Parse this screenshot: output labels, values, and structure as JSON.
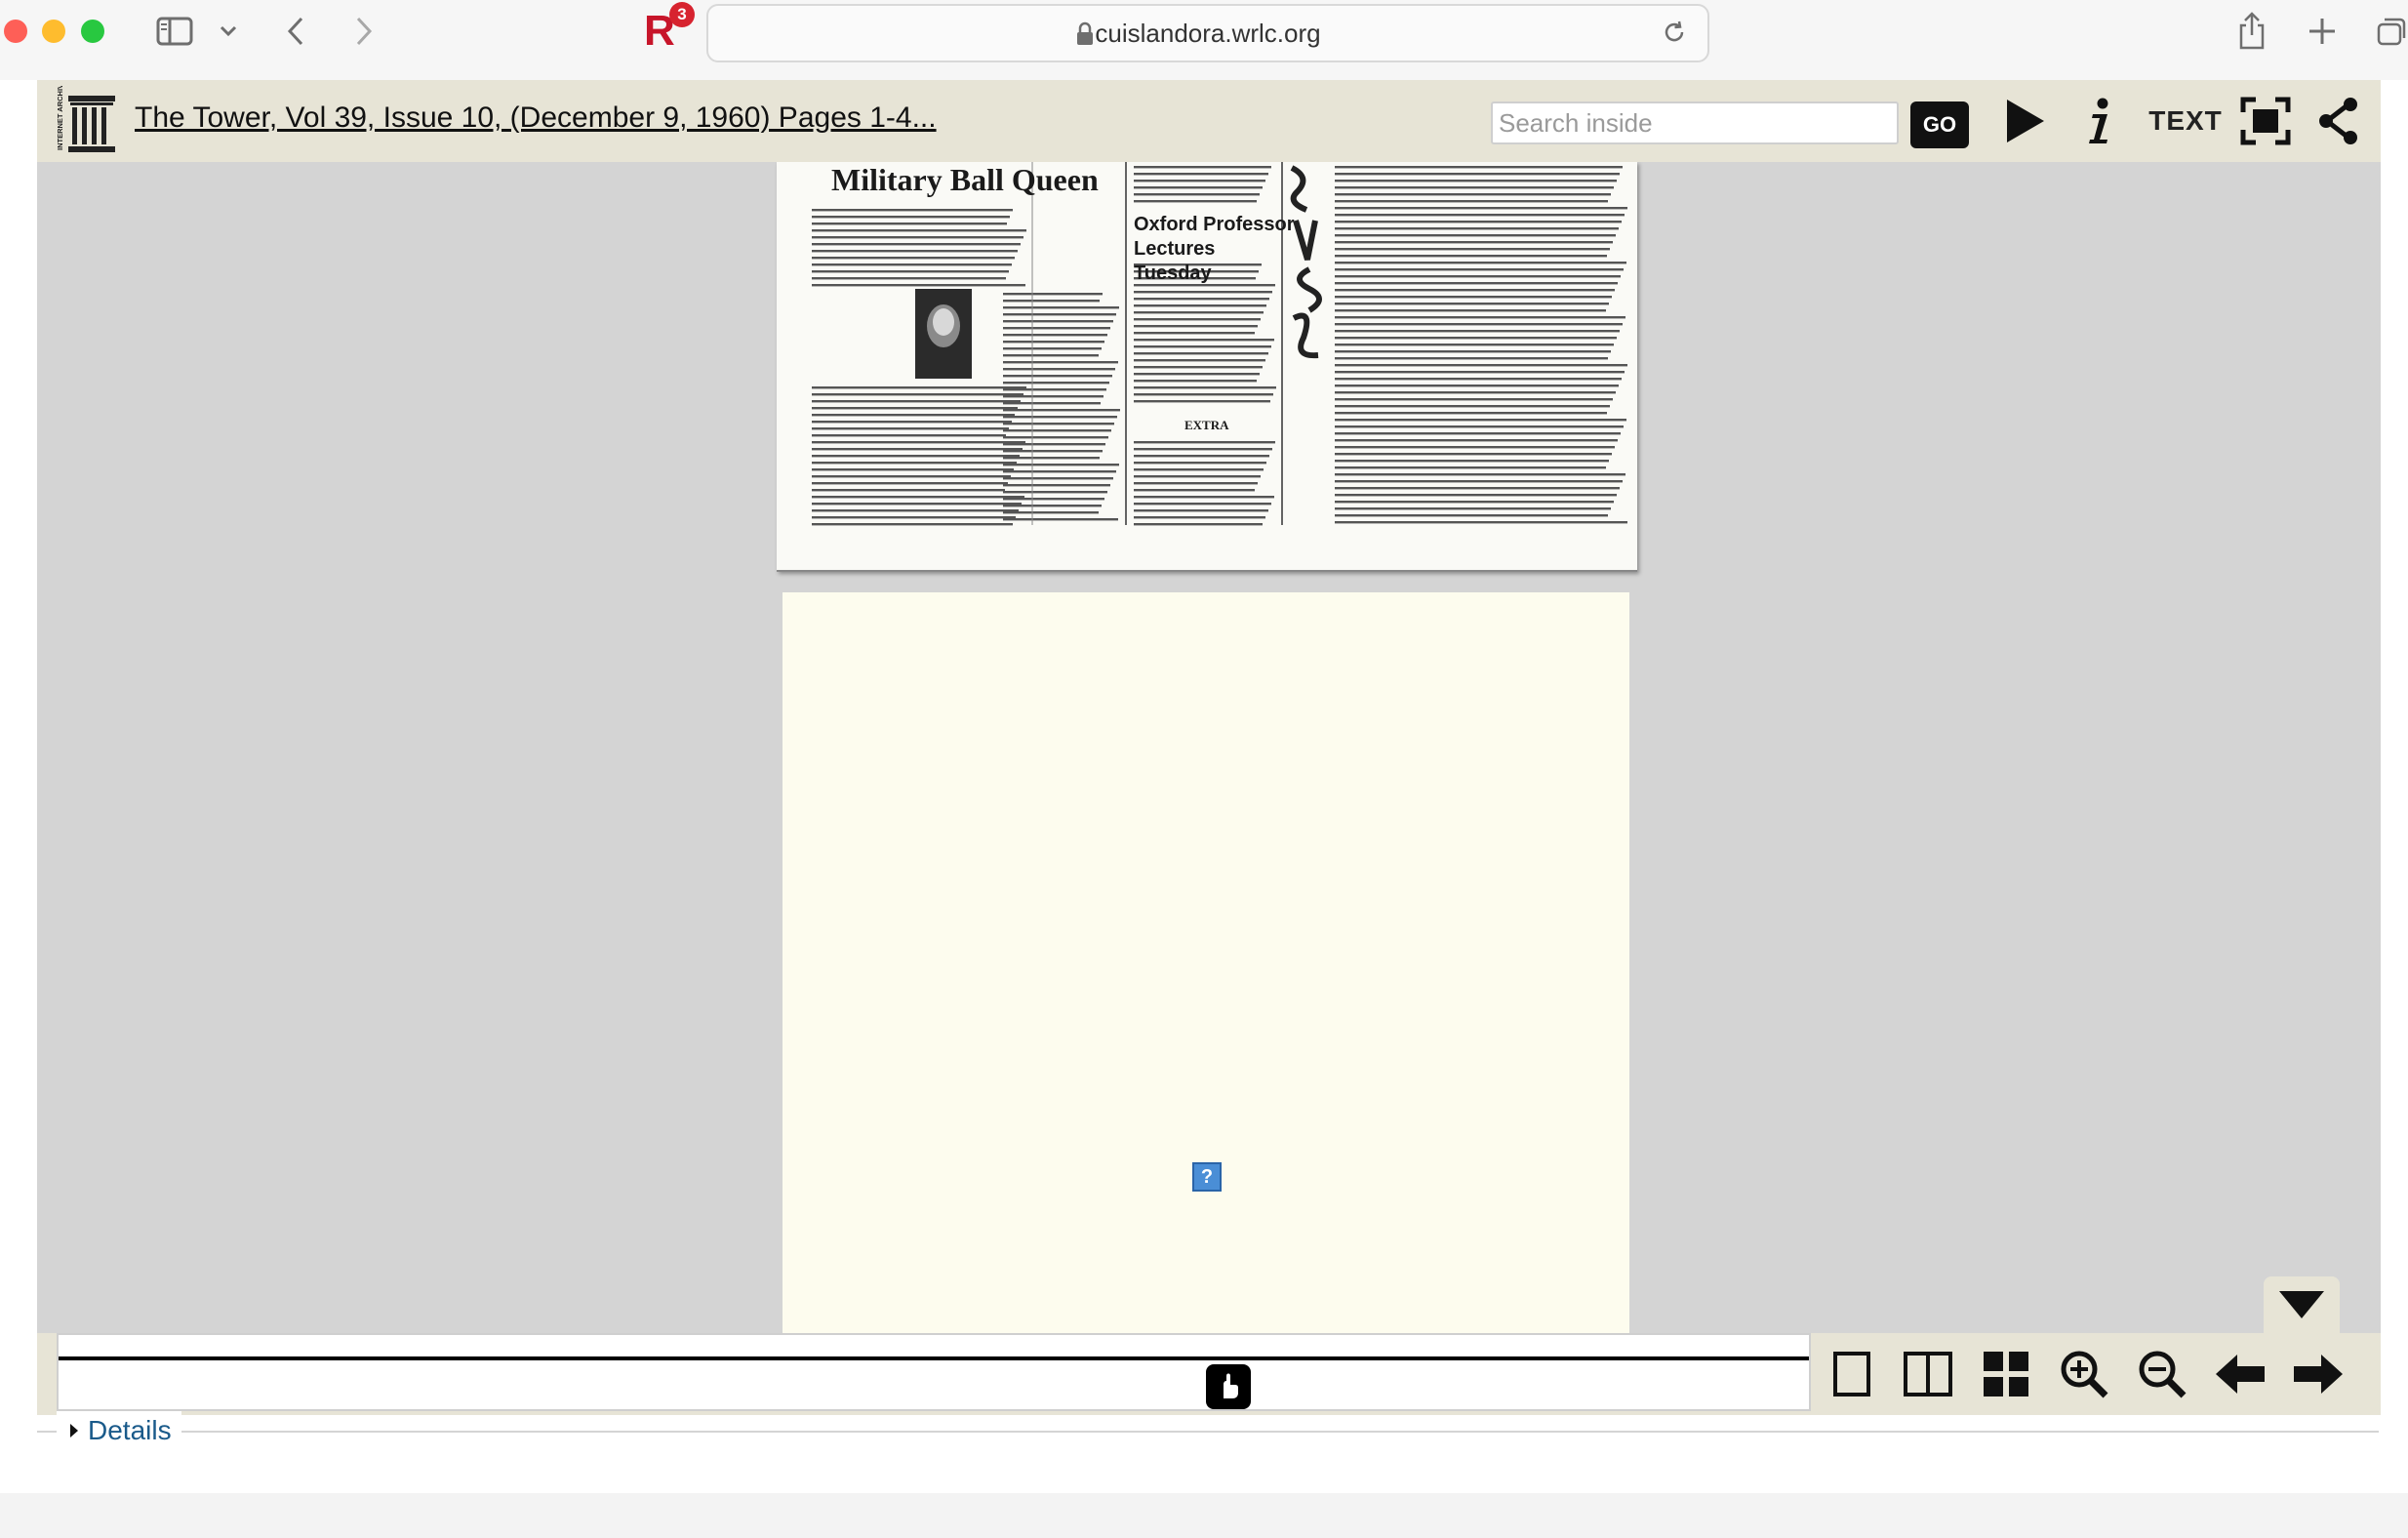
{
  "browser": {
    "url": "cuislandora.wrlc.org",
    "extension_badge": "3",
    "extension_letter": "R"
  },
  "bookreader": {
    "logo_text": "INTERNET ARCHIVE",
    "title": "The Tower, Vol 39, Issue 10, (December 9, 1960) Pages 1-4...",
    "search_placeholder": "Search inside",
    "go_label": "GO",
    "text_mode_label": "TEXT",
    "icons": [
      "play-icon",
      "info-icon",
      "fullscreen-icon",
      "share-icon"
    ]
  },
  "page": {
    "headline_left": "Military Ball Queen",
    "headline_center": "Oxford Professor Lectures Tuesday",
    "box_caption": "EXTRA",
    "missing_image_symbol": "?"
  },
  "footer": {
    "view_icons": [
      "one-page-icon",
      "two-page-icon",
      "thumbnail-grid-icon",
      "zoom-in-icon",
      "zoom-out-icon",
      "previous-page-icon",
      "next-page-icon"
    ],
    "details_label": "Details"
  },
  "colors": {
    "toolbar_bg": "#e7e4d6",
    "viewer_bg": "#d4d4d4",
    "page_bg": "#fdfcee",
    "link": "#1a5a8a"
  }
}
